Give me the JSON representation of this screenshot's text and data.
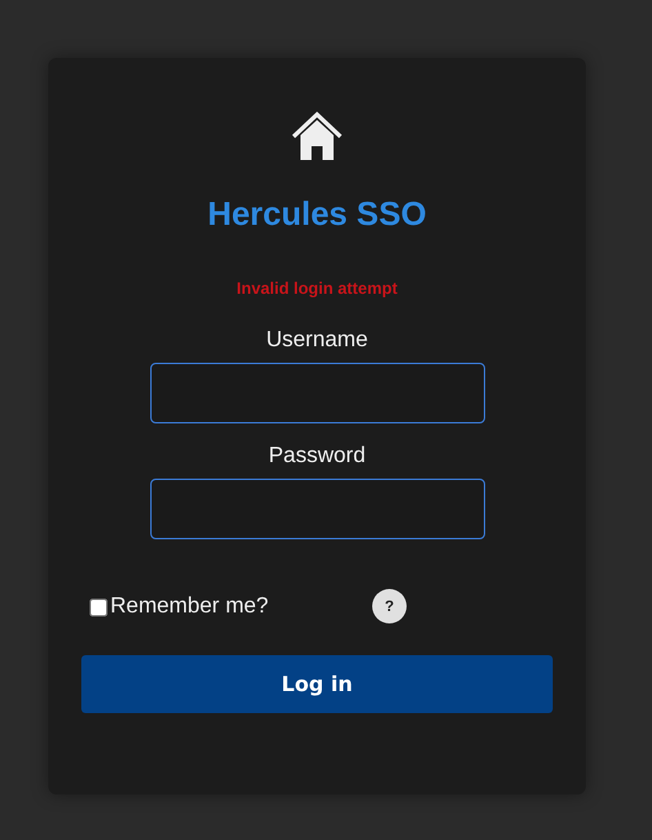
{
  "title": "Hercules SSO",
  "error": "Invalid login attempt",
  "fields": [
    {
      "label": "Username"
    },
    {
      "label": "Password"
    }
  ],
  "remember": {
    "label": "Remember me?",
    "checked": false
  },
  "help": "?",
  "button": "Log in"
}
